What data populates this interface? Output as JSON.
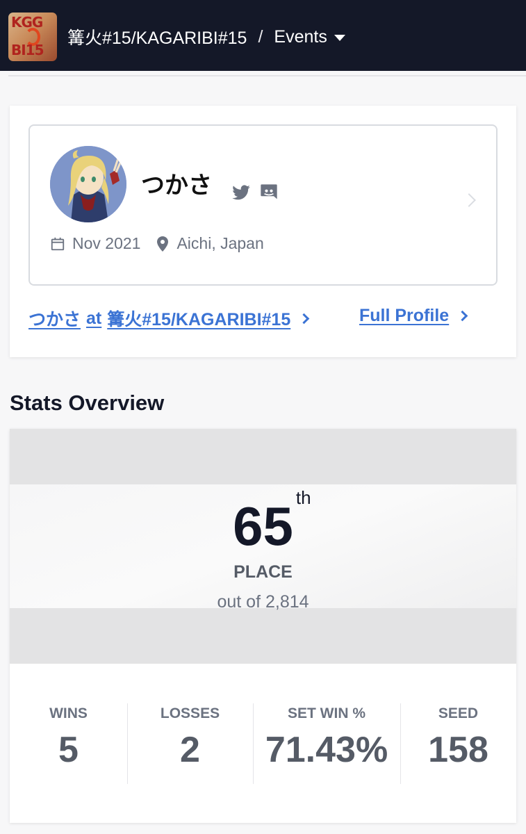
{
  "header": {
    "logo_text_top": "KGG",
    "logo_text_bottom": "BI15",
    "breadcrumb_event": "篝火#15/KAGARIBI#15",
    "breadcrumb_separator": "/",
    "breadcrumb_section": "Events"
  },
  "profile": {
    "name": "つかさ",
    "joined": "Nov 2021",
    "location": "Aichi, Japan",
    "icons": [
      "twitter-icon",
      "discord-icon",
      "calendar-icon",
      "location-pin-icon",
      "chevron-right-icon"
    ]
  },
  "links": {
    "event_profile_name": "つかさ",
    "event_profile_at": "at",
    "event_profile_event": "篝火#15/KAGARIBI#15",
    "full_profile": "Full Profile"
  },
  "stats": {
    "section_title": "Stats Overview",
    "placement": "65",
    "placement_suffix": "th",
    "placement_label": "PLACE",
    "placement_total": "out of 2,814",
    "items": [
      {
        "label": "WINS",
        "value": "5"
      },
      {
        "label": "LOSSES",
        "value": "2"
      },
      {
        "label": "SET WIN %",
        "value": "71.43%"
      },
      {
        "label": "SEED",
        "value": "158"
      }
    ]
  },
  "colors": {
    "nav_bg": "#141828",
    "link": "#3b73d4",
    "muted_text": "#6b7280"
  }
}
